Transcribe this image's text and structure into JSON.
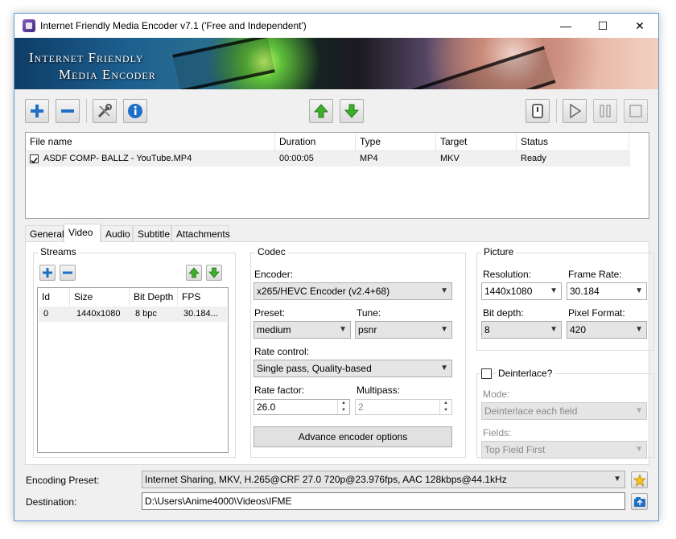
{
  "window": {
    "title": "Internet Friendly Media Encoder v7.1 ('Free and Independent')"
  },
  "titlebar": {
    "minimize": "—",
    "maximize": "☐",
    "close": "✕"
  },
  "banner": {
    "line1": "Internet Friendly",
    "line2": "Media Encoder"
  },
  "toolbar": {
    "add_icon": "plus-icon",
    "remove_icon": "minus-icon",
    "settings_icon": "tools-icon",
    "info_icon": "info-icon",
    "move_up_icon": "arrow-up-icon",
    "move_down_icon": "arrow-down-icon",
    "shutdown_icon": "power-icon",
    "play_icon": "play-icon",
    "pause_icon": "pause-icon",
    "stop_icon": "stop-icon"
  },
  "queue": {
    "columns": [
      "File name",
      "Duration",
      "Type",
      "Target",
      "Status"
    ],
    "rows": [
      {
        "checked": true,
        "file": "ASDF COMP- BALLZ - YouTube.MP4",
        "duration": "00:00:05",
        "type": "MP4",
        "target": "MKV",
        "status": "Ready"
      }
    ]
  },
  "tabs": [
    "General",
    "Video",
    "Audio",
    "Subtitle",
    "Attachments"
  ],
  "active_tab": "Video",
  "streams": {
    "title": "Streams",
    "columns": [
      "Id",
      "Size",
      "Bit Depth",
      "FPS"
    ],
    "rows": [
      {
        "id": "0",
        "size": "1440x1080",
        "bit_depth": "8 bpc",
        "fps": "30.184..."
      }
    ]
  },
  "codec": {
    "title": "Codec",
    "encoder_label": "Encoder:",
    "encoder_value": "x265/HEVC Encoder (v2.4+68)",
    "preset_label": "Preset:",
    "preset_value": "medium",
    "tune_label": "Tune:",
    "tune_value": "psnr",
    "rate_control_label": "Rate control:",
    "rate_control_value": "Single pass, Quality-based",
    "rate_factor_label": "Rate factor:",
    "rate_factor_value": "26.0",
    "multipass_label": "Multipass:",
    "multipass_value": "2",
    "advanced_button": "Advance encoder options"
  },
  "picture": {
    "title": "Picture",
    "resolution_label": "Resolution:",
    "resolution_value": "1440x1080",
    "frame_rate_label": "Frame Rate:",
    "frame_rate_value": "30.184",
    "bit_depth_label": "Bit depth:",
    "bit_depth_value": "8",
    "pixel_format_label": "Pixel Format:",
    "pixel_format_value": "420"
  },
  "deinterlace": {
    "label": "Deinterlace?",
    "checked": false,
    "mode_label": "Mode:",
    "mode_value": "Deinterlace each field",
    "fields_label": "Fields:",
    "fields_value": "Top Field First"
  },
  "footer": {
    "preset_label": "Encoding Preset:",
    "preset_value": "Internet Sharing, MKV, H.265@CRF 27.0 720p@23.976fps, AAC 128kbps@44.1kHz",
    "destination_label": "Destination:",
    "destination_value": "D:\\Users\\Anime4000\\Videos\\IFME",
    "favorite_icon": "star-icon",
    "browse_icon": "folder-browse-icon"
  },
  "colors": {
    "accent": "#0078d7",
    "arrow_green": "#3fae2a",
    "plus_blue": "#1f6fc8"
  }
}
